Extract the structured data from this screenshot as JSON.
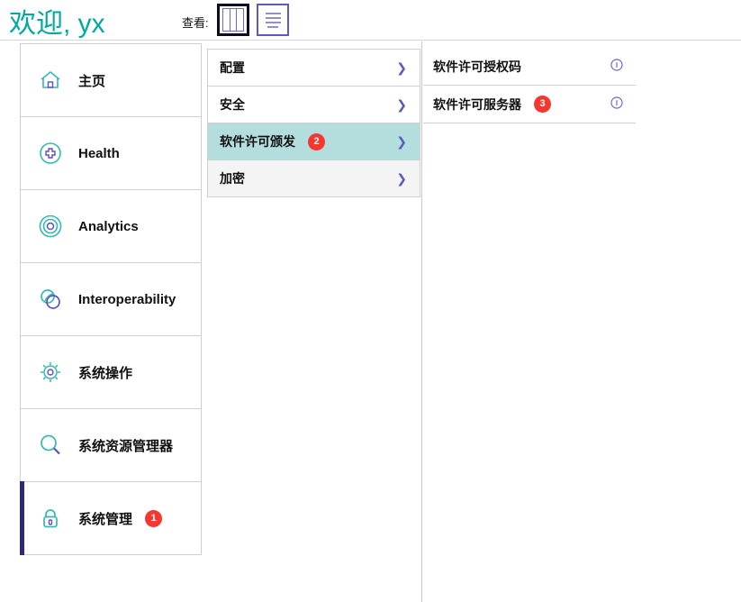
{
  "header": {
    "welcome": "欢迎, yx",
    "view_label": "查看:",
    "view_buttons": [
      {
        "name": "columns-view",
        "icon": "columns-view-icon",
        "selected": true
      },
      {
        "name": "list-view",
        "icon": "list-view-icon",
        "selected": false
      }
    ]
  },
  "colors": {
    "brand_teal": "#00a99d",
    "selected_border": "#2b2b7a",
    "highlight_bg": "#b4dedd",
    "badge_red": "#f4372f",
    "chevron_blue": "#5b5bbd",
    "icon_purple": "#5b4fc4"
  },
  "sidebar": {
    "items": [
      {
        "label": "主页",
        "icon": "home-icon",
        "badge": null,
        "selected": false
      },
      {
        "label": "Health",
        "icon": "health-plus-icon",
        "badge": null,
        "selected": false
      },
      {
        "label": "Analytics",
        "icon": "analytics-target-icon",
        "badge": null,
        "selected": false
      },
      {
        "label": "Interoperability",
        "icon": "interoperability-links-icon",
        "badge": null,
        "selected": false
      },
      {
        "label": "系统操作",
        "icon": "gear-icon",
        "badge": null,
        "selected": false
      },
      {
        "label": "系统资源管理器",
        "icon": "magnifier-icon",
        "badge": null,
        "selected": false
      },
      {
        "label": "系统管理",
        "icon": "lock-icon",
        "badge": "1",
        "selected": true
      }
    ]
  },
  "column2": {
    "items": [
      {
        "label": "配置",
        "badge": null,
        "state": "normal",
        "chevron": "chevron-right-icon"
      },
      {
        "label": "安全",
        "badge": null,
        "state": "normal",
        "chevron": "chevron-right-icon"
      },
      {
        "label": "软件许可颁发",
        "badge": "2",
        "state": "highlighted",
        "chevron": "chevron-right-icon"
      },
      {
        "label": "加密",
        "badge": null,
        "state": "muted",
        "chevron": "chevron-right-icon"
      }
    ]
  },
  "column3": {
    "items": [
      {
        "label": "软件许可授权码",
        "badge": null,
        "info": "info-icon"
      },
      {
        "label": "软件许可服务器",
        "badge": "3",
        "info": "info-icon"
      }
    ]
  }
}
